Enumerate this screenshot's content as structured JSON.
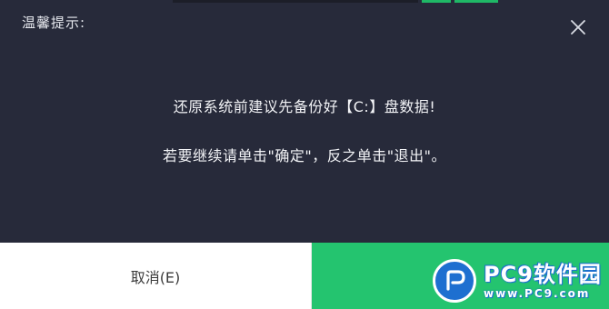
{
  "dialog": {
    "title": "温馨提示:",
    "message_line1": "还原系统前建议先备份好【C:】盘数据!",
    "message_line2": "若要继续请单击\"确定\"，反之单击\"退出\"。",
    "close_icon": "close-icon"
  },
  "buttons": {
    "cancel_label": "取消(E)",
    "ok_label": "()"
  },
  "watermark": {
    "brand": "PC9软件园",
    "url": "www.PC9.com"
  },
  "colors": {
    "dialog_bg": "#272a3a",
    "ok_green": "#24c46f",
    "cancel_bg": "#ffffff",
    "watermark_blue": "#1e6fd0"
  }
}
